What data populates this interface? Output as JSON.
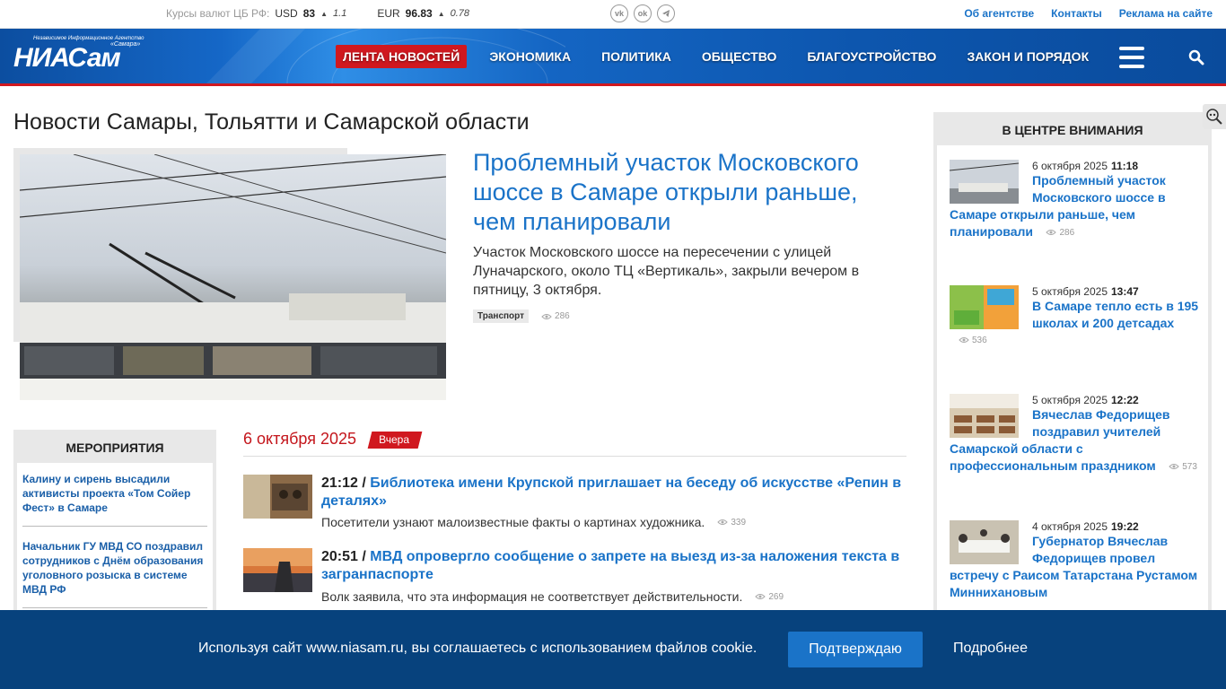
{
  "topbar": {
    "rates_label": "Курсы валют ЦБ РФ:",
    "usd": {
      "code": "USD",
      "value": "83",
      "change": "1.1"
    },
    "eur": {
      "code": "EUR",
      "value": "96.83",
      "change": "0.78"
    },
    "socials": [
      "vk-icon",
      "ok-icon",
      "telegram-icon"
    ],
    "links": [
      "Об агентстве",
      "Контакты",
      "Реклама на сайте"
    ]
  },
  "header": {
    "logo_small": "Независимое Информационное Агентство",
    "logo_main": "НИАСам",
    "logo_sub": "«Самара»",
    "nav": [
      "Лента новостей",
      "Экономика",
      "Политика",
      "Общество",
      "Благоустройство",
      "Закон и порядок"
    ],
    "accent_color": "#d0181f"
  },
  "main": {
    "page_title": "Новости Самары, Тольятти и Самарской области",
    "hero": {
      "title": "Проблемный участок Московского шоссе в Самаре открыли раньше, чем планировали",
      "text": "Участок Московского шоссе на пересечении с улицей Луначарского, около ТЦ «Вертикаль», закрыли вечером в пятницу, 3 октября.",
      "tag": "Транспорт",
      "views": "286"
    }
  },
  "events": {
    "title": "МЕРОПРИЯТИЯ",
    "items": [
      "Калину и сирень высадили активисты проекта «Том Сойер Фест» в Самаре",
      "Начальник ГУ МВД СО поздравил сотрудников с Днём образования уголовного розыска в системе МВД РФ"
    ]
  },
  "feed": {
    "date": "6 октября 2025",
    "badge": "Вчера",
    "items": [
      {
        "time": "21:12 /",
        "title": "Библиотека имени Крупской приглашает на беседу об искусстве «Репин в деталях»",
        "desc": "Посетители узнают малоизвестные факты о картинах художника.",
        "views": "339"
      },
      {
        "time": "20:51 /",
        "title": "МВД опровергло сообщение о запрете на выезд из-за наложения текста в загранпаспорте",
        "desc": "Волк заявила, что эта информация не соответствует действительности.",
        "views": "269"
      }
    ]
  },
  "sidebar": {
    "title": "В ЦЕНТРЕ ВНИМАНИЯ",
    "items": [
      {
        "date": "6 октября 2025",
        "time": "11:18",
        "title": "Проблемный участок Московского шоссе в Самаре открыли раньше, чем планировали",
        "views": "286"
      },
      {
        "date": "5 октября 2025",
        "time": "13:47",
        "title": "В Самаре тепло есть в 195 школах и 200 детсадах",
        "views": "536"
      },
      {
        "date": "5 октября 2025",
        "time": "12:22",
        "title": "Вячеслав Федорищев поздравил учителей Самарской области с профессиональным праздником",
        "views": "573"
      },
      {
        "date": "4 октября 2025",
        "time": "19:22",
        "title": "Губернатор Вячеслав Федорищев провел встречу с Раисом Татарстана Рустамом Миннихановым",
        "views": ""
      }
    ]
  },
  "cookie": {
    "text": "Используя сайт www.niasam.ru, вы соглашаетесь с использованием файлов cookie.",
    "confirm": "Подтверждаю",
    "more": "Подробнее"
  }
}
